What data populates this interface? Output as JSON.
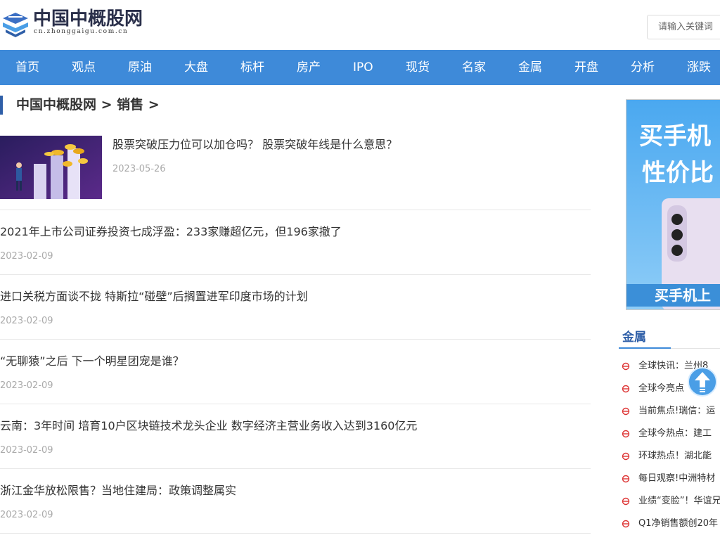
{
  "site": {
    "logo_title": "中国中概股网",
    "logo_sub": "cn.zhonggaigu.com.cn"
  },
  "search": {
    "placeholder": "请输入关键词"
  },
  "nav": [
    "首页",
    "观点",
    "原油",
    "大盘",
    "标杆",
    "房产",
    "IPO",
    "现货",
    "名家",
    "金属",
    "开盘",
    "分析",
    "涨跌"
  ],
  "breadcrumb": "中国中概股网 > 销售 >",
  "articles": [
    {
      "title": "股票突破压力位可以加仓吗？ 股票突破年线是什么意思？",
      "date": "2023-05-26"
    },
    {
      "title": "2021年上市公司证券投资七成浮盈：233家赚超亿元，但196家撤了",
      "date": "2023-02-09"
    },
    {
      "title": "进口关税方面谈不拢 特斯拉“碰壁”后搁置进军印度市场的计划",
      "date": "2023-02-09"
    },
    {
      "title": "“无聊猿”之后 下一个明星团宠是谁？",
      "date": "2023-02-09"
    },
    {
      "title": "云南：3年时间 培育10户区块链技术龙头企业 数字经济主营业务收入达到3160亿元",
      "date": "2023-02-09"
    },
    {
      "title": "浙江金华放松限售？当地住建局：政策调整属实",
      "date": "2023-02-09"
    }
  ],
  "ad": {
    "line1": "买手机",
    "line2": "性价比",
    "bottom": "买手机上"
  },
  "sidebar": {
    "title": "金属",
    "items": [
      "全球快讯：兰州8",
      "全球今亮点",
      "当前焦点!瑞信：运",
      "全球今热点：建工",
      "环球热点！湖北能",
      "每日观察!中洲特材",
      "业绩“变脸”！华谊兄",
      "Q1净销售额创20年"
    ]
  },
  "colors": {
    "nav_bg": "#3e8ad9",
    "accent": "#2f5fa8",
    "date": "#aaaaaa"
  }
}
